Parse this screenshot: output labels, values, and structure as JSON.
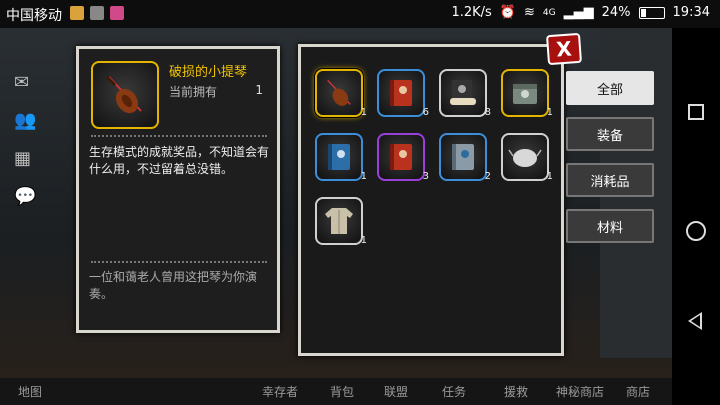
{
  "statusbar": {
    "carrier": "中国移动",
    "speed": "1.2K/s",
    "network": "4G",
    "battery": "24%",
    "time": "19:34"
  },
  "game": {
    "bottom_nav": [
      "地图",
      "幸存者",
      "背包",
      "联盟",
      "任务",
      "援救",
      "神秘商店",
      "商店"
    ]
  },
  "detail": {
    "name": "破损的小提琴",
    "owned_label": "当前拥有",
    "owned_count": "1",
    "description": "生存模式的成就奖品，不知道会有什么用，不过留着总没错。",
    "flavor": "一位和蔼老人曾用这把琴为你演奏。"
  },
  "inventory": {
    "items": [
      {
        "icon": "violin-icon",
        "count": "1",
        "rarity": "gold"
      },
      {
        "icon": "red-book-icon",
        "count": "6",
        "rarity": "blue"
      },
      {
        "icon": "blueprint-icon",
        "count": "8",
        "rarity": "white"
      },
      {
        "icon": "green-book-icon",
        "count": "1",
        "rarity": "gold"
      },
      {
        "icon": "blue-book-icon",
        "count": "1",
        "rarity": "blue"
      },
      {
        "icon": "red-book-icon",
        "count": "3",
        "rarity": "purple"
      },
      {
        "icon": "grey-book-icon",
        "count": "2",
        "rarity": "blue"
      },
      {
        "icon": "mask-icon",
        "count": "1",
        "rarity": "white"
      },
      {
        "icon": "jacket-icon",
        "count": "1",
        "rarity": "white"
      }
    ]
  },
  "tabs": [
    "全部",
    "装备",
    "消耗品",
    "材料"
  ],
  "close_label": "X"
}
